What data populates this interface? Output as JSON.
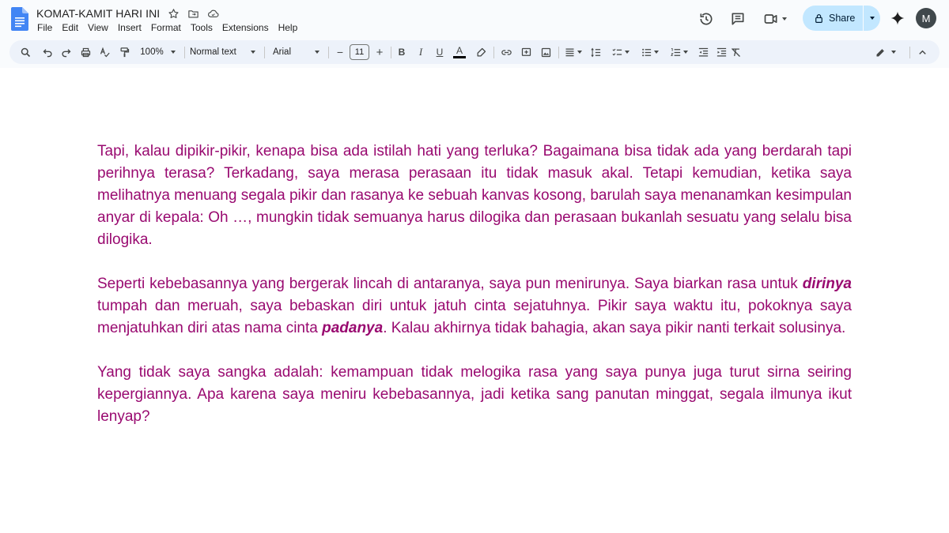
{
  "document": {
    "title": "KOMAT-KAMIT HARI INI",
    "menu": [
      "File",
      "Edit",
      "View",
      "Insert",
      "Format",
      "Tools",
      "Extensions",
      "Help"
    ]
  },
  "header": {
    "share_label": "Share",
    "avatar_initial": "M"
  },
  "toolbar": {
    "zoom": "100%",
    "style": "Normal text",
    "font": "Arial",
    "font_size": "11",
    "decrease": "−",
    "increase": "+",
    "bold": "B",
    "italic": "I",
    "underline": "U",
    "text_color": "A"
  },
  "body": {
    "p1": "Tapi, kalau dipikir-pikir, kenapa bisa ada istilah hati yang terluka? Bagaimana bisa tidak ada yang berdarah tapi perihnya terasa? Terkadang, saya merasa perasaan itu tidak masuk akal. Tetapi kemudian, ketika saya melihatnya menuang segala pikir dan rasanya ke sebuah kanvas kosong, barulah saya menanamkan kesimpulan anyar di kepala: Oh …, mungkin tidak semuanya harus dilogika dan perasaan bukanlah sesuatu yang selalu bisa dilogika.",
    "p2_a": "Seperti kebebasannya yang bergerak lincah di antaranya, saya pun menirunya. Saya biarkan rasa untuk ",
    "p2_b": "dirinya",
    "p2_c": " tumpah dan meruah, saya bebaskan diri untuk jatuh cinta sejatuhnya. Pikir saya waktu itu, pokoknya saya menjatuhkan diri atas nama cinta ",
    "p2_d": "padanya",
    "p2_e": ". Kalau akhirnya tidak bahagia, akan saya pikir nanti terkait solusinya.",
    "p3": "Yang tidak saya sangka adalah: kemampuan tidak melogika rasa yang saya punya juga turut sirna seiring kepergiannya. Apa karena saya meniru kebebasannya, jadi ketika sang panutan minggat, segala ilmunya ikut lenyap?"
  },
  "colors": {
    "text": "#990a70",
    "share_bg": "#c2e7ff",
    "toolbar_bg": "#edf2fa",
    "avatar_bg": "#40484c"
  },
  "icons": [
    "docs-logo",
    "star-icon",
    "move-folder-icon",
    "cloud-icon",
    "history-icon",
    "comment-icon",
    "meet-icon",
    "lock-icon",
    "gemini-icon",
    "search-icon",
    "undo-icon",
    "redo-icon",
    "print-icon",
    "spellcheck-icon",
    "paint-format-icon",
    "text-color-icon",
    "highlight-icon",
    "link-icon",
    "add-comment-icon",
    "image-icon",
    "align-icon",
    "line-spacing-icon",
    "checklist-icon",
    "bullet-list-icon",
    "numbered-list-icon",
    "indent-decrease-icon",
    "indent-increase-icon",
    "clear-format-icon",
    "edit-mode-icon",
    "collapse-icon"
  ]
}
